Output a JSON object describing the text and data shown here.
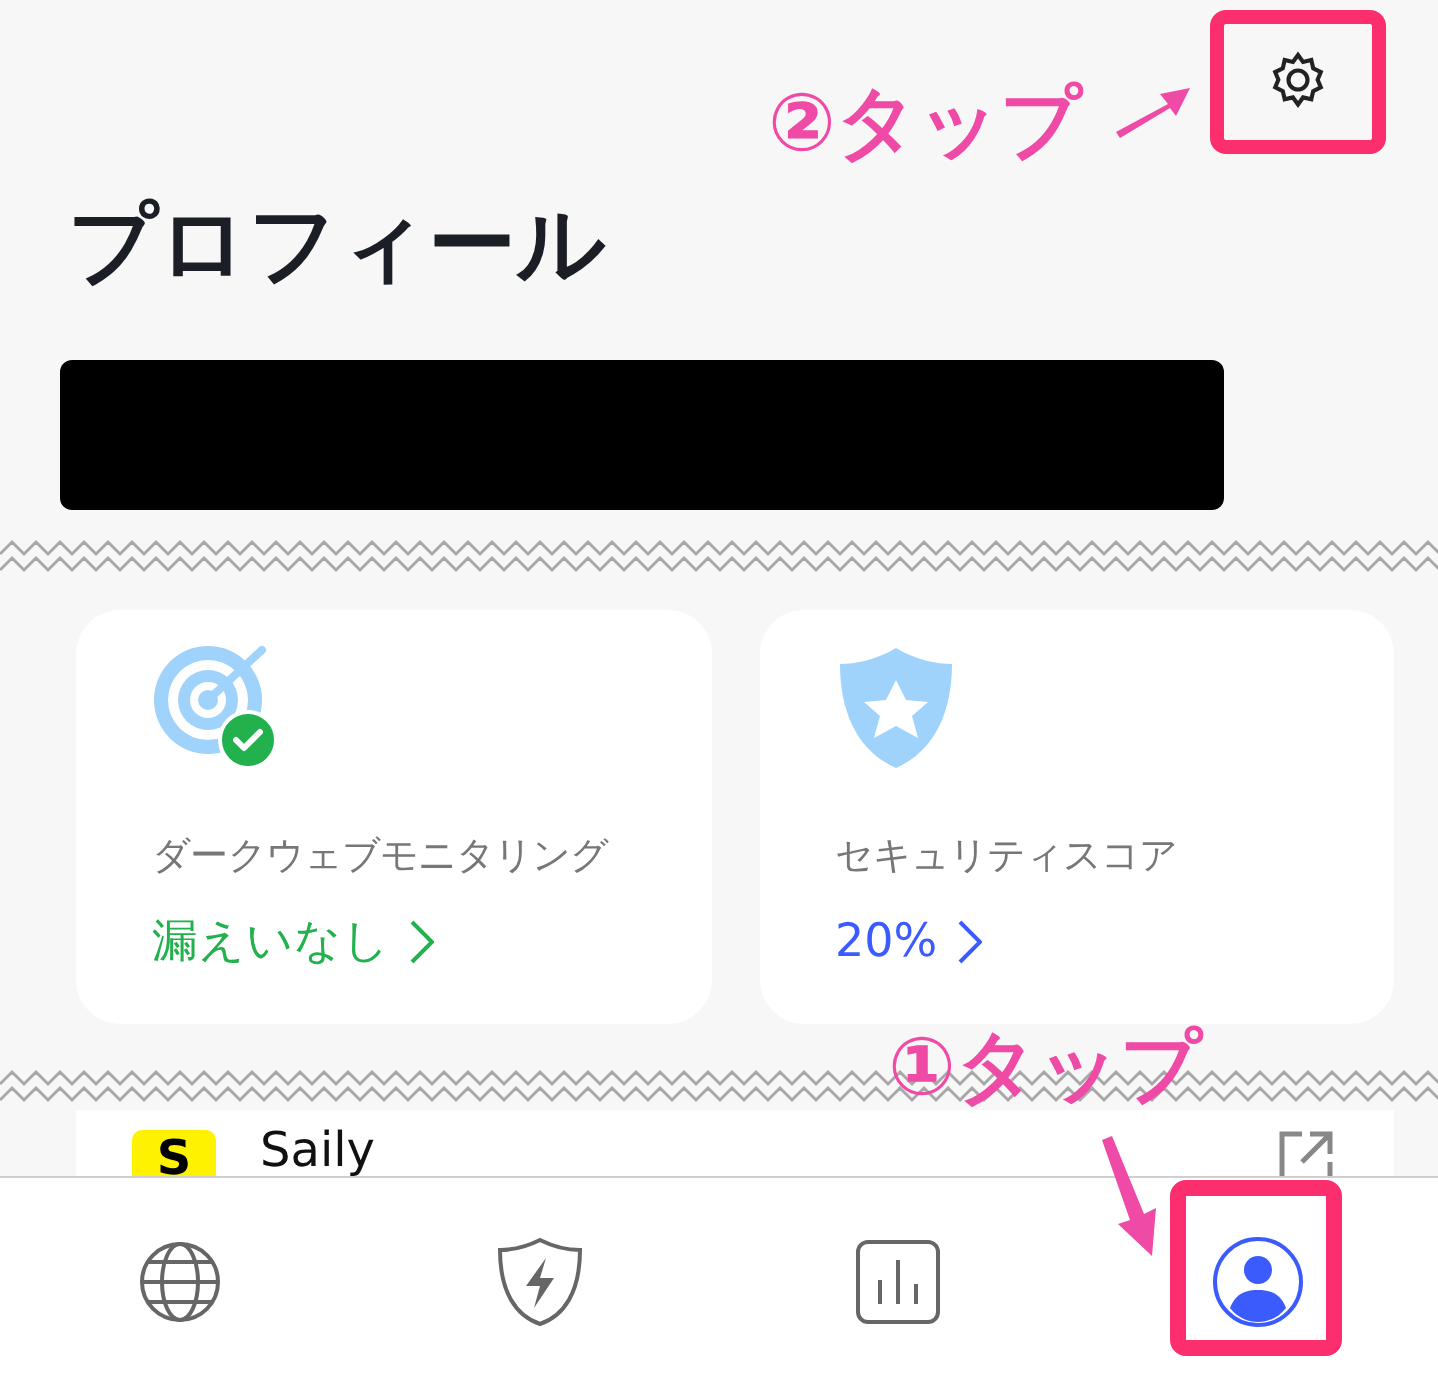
{
  "header": {
    "title": "プロフィール"
  },
  "annotations": [
    {
      "label": "②タップ"
    },
    {
      "label": "①タップ"
    }
  ],
  "cards": [
    {
      "kind": "monitoring",
      "label": "ダークウェブモニタリング",
      "value": "漏えいなし"
    },
    {
      "kind": "score",
      "label": "セキュリティスコア",
      "value": "20%"
    }
  ],
  "apps": [
    {
      "logo": "S",
      "name": "Saily"
    }
  ],
  "nav": [
    {
      "kind": "globe",
      "selected": false
    },
    {
      "kind": "shield",
      "selected": false
    },
    {
      "kind": "stats",
      "selected": false
    },
    {
      "kind": "profile",
      "selected": true
    }
  ]
}
